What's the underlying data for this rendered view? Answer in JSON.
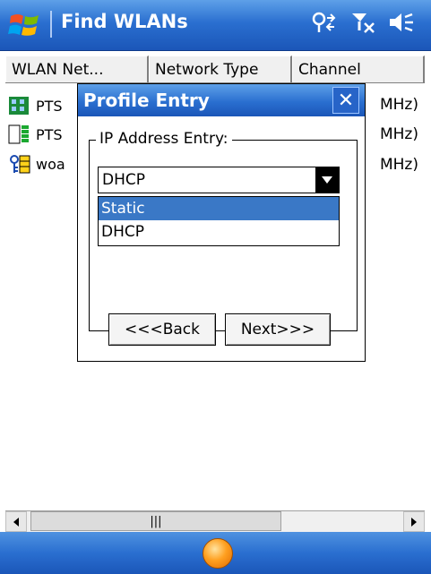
{
  "titlebar": {
    "title": "Find WLANs"
  },
  "list": {
    "columns": [
      "WLAN Net...",
      "Network Type",
      "Channel"
    ],
    "rows": [
      {
        "name": "PTS",
        "channel_suffix": "MHz)"
      },
      {
        "name": "PTS",
        "channel_suffix": "MHz)"
      },
      {
        "name": "woa",
        "channel_suffix": "MHz)"
      }
    ]
  },
  "dialog": {
    "title": "Profile Entry",
    "close": "✕",
    "group_label": "IP Address Entry:",
    "combo_value": "DHCP",
    "options": [
      "Static",
      "DHCP"
    ],
    "back_label": "<<<Back",
    "next_label": "Next>>>"
  },
  "scrollbar": {
    "thumb_grip": "|||"
  },
  "colors": {
    "accent": "#2a6fd0",
    "selection": "#3a78c6",
    "softkey_orb": "#ffa020"
  }
}
